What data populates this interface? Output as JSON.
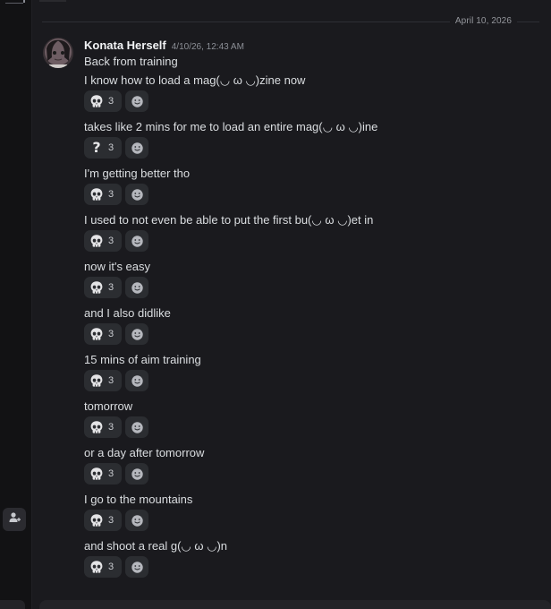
{
  "divider": {
    "date": "April 10, 2026"
  },
  "message": {
    "author": "Konata Herself",
    "timestamp": "4/10/26, 12:43 AM",
    "avatar_icon": "avatar-image",
    "first_line": "Back from training",
    "lines": [
      {
        "text": "I know how to load a mag(◡ ω ◡)zine now",
        "reaction": {
          "emoji": "skull-icon",
          "count": "3"
        }
      },
      {
        "text": "takes like 2 mins for me to load an entire mag(◡ ω ◡)ine",
        "reaction": {
          "emoji": "question-icon",
          "count": "3"
        }
      },
      {
        "text": "I'm getting better tho",
        "reaction": {
          "emoji": "skull-icon",
          "count": "3"
        }
      },
      {
        "text": "I used to not even be able to put the first bu(◡ ω ◡)et in",
        "reaction": {
          "emoji": "skull-icon",
          "count": "3"
        }
      },
      {
        "text": "now it's easy",
        "reaction": {
          "emoji": "skull-icon",
          "count": "3"
        }
      },
      {
        "text": "and I also didlike",
        "reaction": {
          "emoji": "skull-icon",
          "count": "3"
        }
      },
      {
        "text": "15 mins of aim training",
        "reaction": {
          "emoji": "skull-icon",
          "count": "3"
        }
      },
      {
        "text": "tomorrow",
        "reaction": {
          "emoji": "skull-icon",
          "count": "3"
        }
      },
      {
        "text": "or a day after tomorrow",
        "reaction": {
          "emoji": "skull-icon",
          "count": "3"
        }
      },
      {
        "text": "I go to the mountains",
        "reaction": {
          "emoji": "skull-icon",
          "count": "3"
        }
      },
      {
        "text": "and shoot a real g(◡ ω ◡)n",
        "reaction": {
          "emoji": "skull-icon",
          "count": "3"
        }
      }
    ]
  },
  "icons": {
    "add_reaction": "add-reaction-icon",
    "add_friend": "add-friend-icon"
  },
  "colors": {
    "background": "#1a1a1e",
    "rail": "#121214",
    "reaction_pill": "#2b2d31",
    "author": "#f2f3f5",
    "muted": "#8c8f96"
  }
}
